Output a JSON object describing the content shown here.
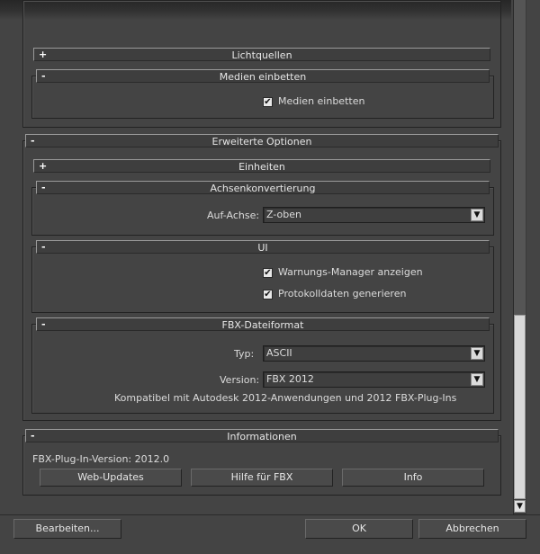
{
  "rollouts": {
    "lichtquellen": {
      "sign": "+",
      "title": "Lichtquellen"
    },
    "medien": {
      "sign": "-",
      "title": "Medien einbetten",
      "checkbox_label": "Medien einbetten",
      "checked": true
    },
    "erweitert": {
      "sign": "-",
      "title": "Erweiterte Optionen"
    },
    "einheiten": {
      "sign": "+",
      "title": "Einheiten"
    },
    "achsen": {
      "sign": "-",
      "title": "Achsenkonvertierung",
      "axis_label": "Auf-Achse:",
      "axis_value": "Z-oben"
    },
    "ui": {
      "sign": "-",
      "title": "UI",
      "warn_label": "Warnungs-Manager anzeigen",
      "log_label": "Protokolldaten generieren"
    },
    "fbx": {
      "sign": "-",
      "title": "FBX-Dateiformat",
      "type_label": "Typ:",
      "type_value": "ASCII",
      "version_label": "Version:",
      "version_value": "FBX 2012",
      "compat_text": "Kompatibel mit Autodesk 2012-Anwendungen und 2012 FBX-Plug-Ins"
    },
    "info": {
      "sign": "-",
      "title": "Informationen",
      "version_text": "FBX-Plug-In-Version: 2012.0",
      "web_updates": "Web-Updates",
      "hilfe": "Hilfe für FBX",
      "info_btn": "Info"
    }
  },
  "footer": {
    "bearbeiten": "Bearbeiten...",
    "ok": "OK",
    "abbrechen": "Abbrechen"
  },
  "icons": {
    "check": "✔",
    "dropdown": "▼",
    "scroll_down": "▼"
  }
}
